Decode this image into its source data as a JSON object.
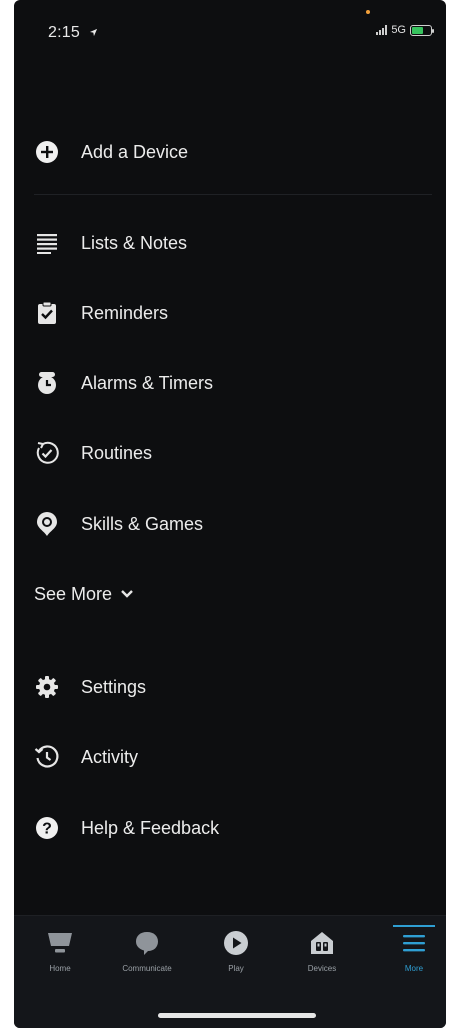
{
  "status_bar": {
    "time": "2:15",
    "network": "5G"
  },
  "menu": {
    "add_device": "Add a Device",
    "lists_notes": "Lists & Notes",
    "reminders": "Reminders",
    "alarms_timers": "Alarms & Timers",
    "routines": "Routines",
    "skills_games": "Skills & Games",
    "see_more": "See More",
    "settings": "Settings",
    "activity": "Activity",
    "help_feedback": "Help & Feedback"
  },
  "bottom_nav": {
    "home": "Home",
    "communicate": "Communicate",
    "play": "Play",
    "devices": "Devices",
    "more": "More",
    "active": "More"
  },
  "colors": {
    "background": "#0d0e10",
    "accent": "#2f9fd3",
    "battery": "#37c25e"
  }
}
